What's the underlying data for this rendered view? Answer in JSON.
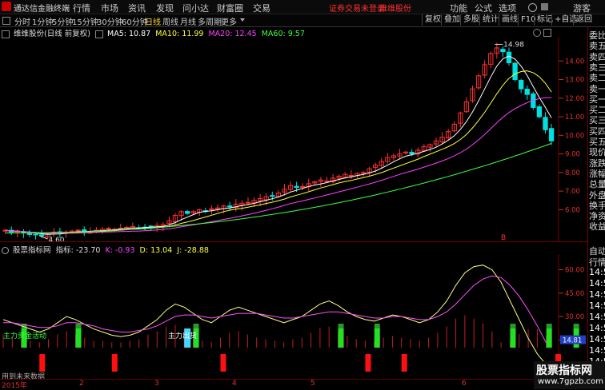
{
  "menubar": {
    "app_title": "通达信金融终端",
    "items": [
      "行情",
      "市场",
      "资讯",
      "发现",
      "问小达",
      "财富圈",
      "交易"
    ],
    "login_warning": "证券交易未登录",
    "stock_name": "维维股份",
    "right_items": [
      "功能",
      "公式",
      "选项"
    ],
    "guest": "游客"
  },
  "toolbar": {
    "periods": [
      "分时",
      "1分钟",
      "5分钟",
      "15分钟",
      "30分钟",
      "60分钟",
      "日线",
      "周线",
      "月线",
      "多周期",
      "更多"
    ],
    "active": "日线",
    "right_items": [
      "复权",
      "叠加",
      "多股",
      "统计",
      "画线",
      "F10",
      "标记",
      "+自选",
      "返回"
    ]
  },
  "main_chart": {
    "caption": "维维股份(日线 前复权)",
    "ma": [
      {
        "label": "MA5: 10.87",
        "color": "#ffffff"
      },
      {
        "label": "MA10: 11.99",
        "color": "#ffff40"
      },
      {
        "label": "MA20: 12.45",
        "color": "#ff40ff"
      },
      {
        "label": "MA60: 9.57",
        "color": "#40ff40"
      }
    ],
    "high_label": "14.98",
    "low_label": "4.60",
    "marker": "B"
  },
  "indicator": {
    "name": "股票指标网",
    "label": "指标:",
    "value": "-23.70",
    "k": "K: -0.93",
    "d": "D: 13.04",
    "j": "J: -28.88",
    "label_a": "主力资金活动",
    "label_b": "主力出货",
    "value_tag": "14.81",
    "no_data": "用到未来数据"
  },
  "right_panel": {
    "quotes": [
      "委比",
      "卖五",
      "卖四",
      "卖三",
      "卖二",
      "卖一",
      "买一",
      "买二",
      "买三",
      "买四",
      "买五",
      "现价",
      "涨跌",
      "涨幅",
      "总量",
      "外盘",
      "换手",
      "净资",
      "收益"
    ],
    "indicator_items": [
      "自动",
      "行情",
      "14:5",
      "14:5",
      "14:5",
      "14:5",
      "14:5",
      "14:5",
      "14:5",
      "14:5",
      "14:5"
    ]
  },
  "chart_data": [
    {
      "type": "candlestick",
      "y_ticks": [
        "14.00",
        "13.00",
        "12.00",
        "11.00",
        "10.00",
        "9.00",
        "8.00",
        "7.00",
        "6.00"
      ],
      "ylim": [
        4.3,
        15.3
      ],
      "x_ticks": [
        "2015年",
        "2",
        "3",
        "4",
        "5",
        "6"
      ],
      "closes": [
        4.9,
        4.8,
        4.85,
        4.75,
        4.7,
        4.65,
        4.6,
        4.7,
        4.8,
        4.75,
        4.8,
        4.85,
        4.9,
        4.85,
        4.8,
        4.9,
        4.95,
        5.0,
        4.95,
        5.0,
        5.05,
        5.1,
        5.0,
        5.05,
        5.1,
        5.15,
        5.2,
        5.4,
        5.7,
        5.9,
        5.8,
        5.9,
        6.0,
        5.95,
        6.05,
        6.1,
        6.2,
        6.15,
        6.3,
        6.35,
        6.4,
        6.5,
        6.6,
        6.7,
        6.75,
        6.9,
        7.1,
        7.3,
        7.2,
        7.25,
        7.4,
        7.5,
        7.6,
        7.55,
        7.7,
        7.8,
        7.9,
        7.85,
        7.95,
        8.0,
        8.2,
        8.4,
        8.6,
        8.8,
        8.9,
        9.0,
        9.1,
        9.0,
        9.2,
        9.4,
        9.5,
        9.7,
        9.9,
        10.2,
        10.6,
        11.2,
        11.8,
        12.5,
        13.2,
        13.8,
        14.4,
        14.7,
        14.5,
        13.9,
        13.0,
        12.5,
        12.2,
        11.5,
        11.0,
        10.3,
        9.7
      ],
      "ma60_end": 9.57
    },
    {
      "type": "line",
      "y_ticks": [
        "60.00",
        "45.00",
        "30.00",
        "15.00"
      ],
      "ylim": [
        -10,
        70
      ],
      "series": [
        {
          "name": "K",
          "values": [
            28,
            26,
            24,
            22,
            20,
            22,
            26,
            30,
            28,
            25,
            22,
            20,
            18,
            17,
            18,
            20,
            24,
            28,
            34,
            38,
            36,
            32,
            28,
            26,
            30,
            34,
            36,
            34,
            32,
            30,
            28,
            26,
            28,
            30,
            34,
            38,
            40,
            37,
            33,
            30,
            28,
            27,
            29,
            31,
            30,
            28,
            26,
            28,
            33,
            40,
            50,
            58,
            62,
            63,
            60,
            52,
            40,
            28,
            16,
            6,
            -1
          ]
        },
        {
          "name": "D",
          "values": [
            26,
            26,
            25,
            24,
            23,
            23,
            24,
            26,
            26,
            25,
            24,
            22,
            21,
            20,
            20,
            21,
            22,
            24,
            27,
            30,
            31,
            31,
            30,
            29,
            30,
            31,
            32,
            32,
            32,
            31,
            30,
            29,
            29,
            30,
            31,
            32,
            33,
            33,
            32,
            31,
            30,
            29,
            29,
            30,
            30,
            29,
            28,
            28,
            30,
            33,
            38,
            44,
            50,
            54,
            56,
            55,
            50,
            43,
            34,
            24,
            13
          ]
        }
      ]
    }
  ]
}
